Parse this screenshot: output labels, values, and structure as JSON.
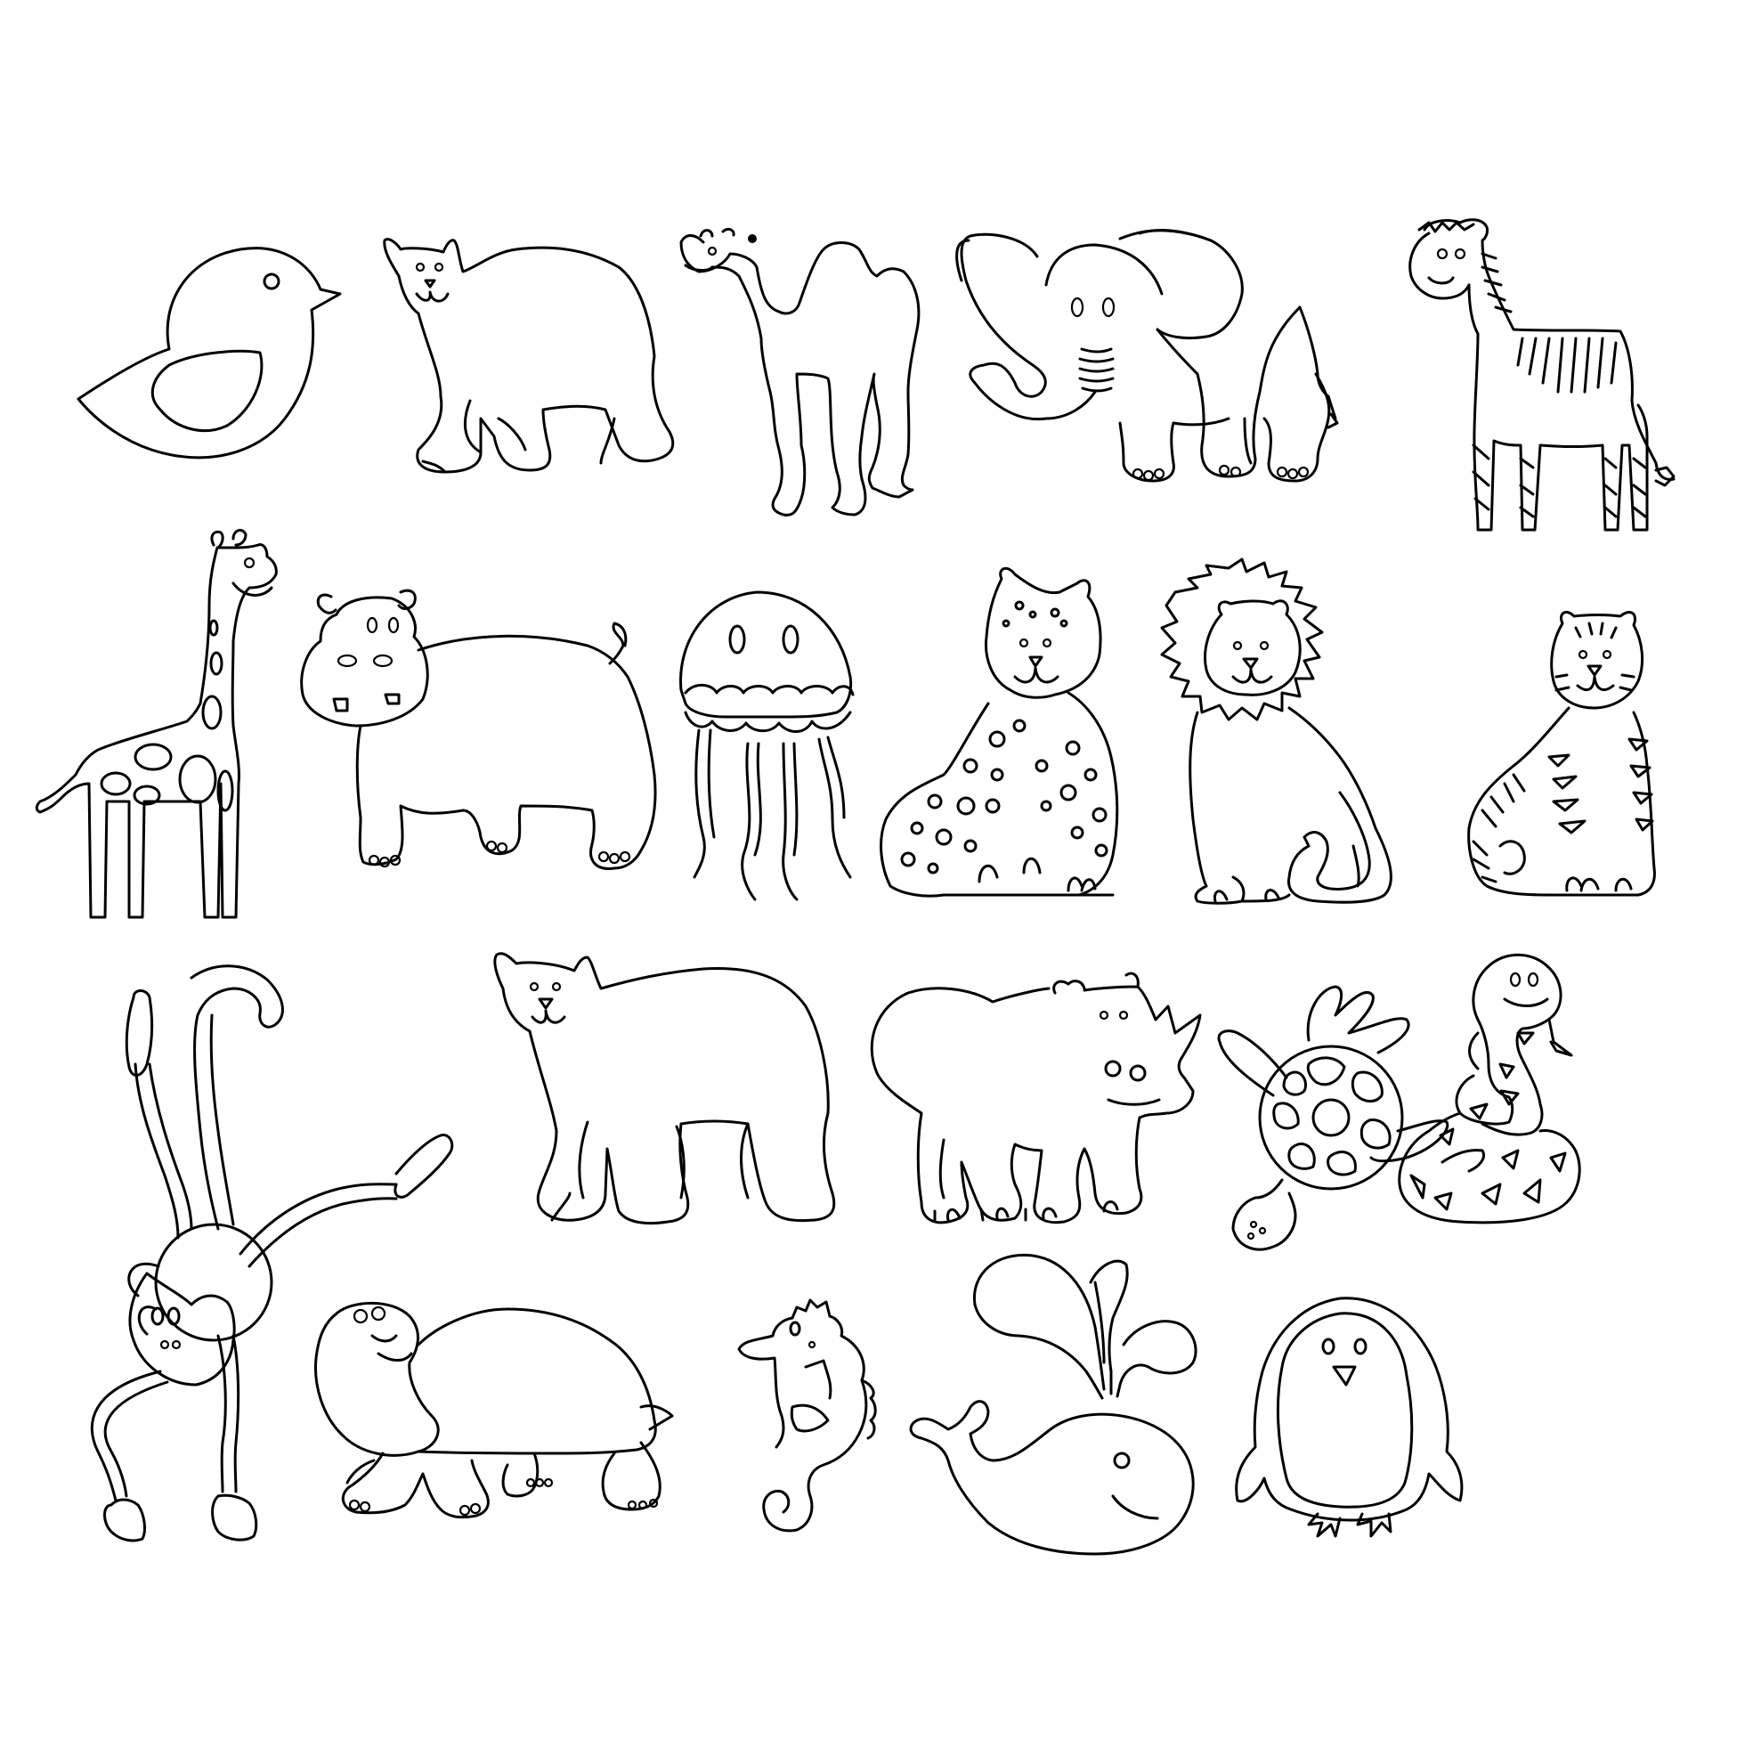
{
  "page": {
    "background": "#ffffff",
    "ink": "#000000",
    "style": "coloring-page line art"
  },
  "animals": [
    {
      "id": "bird-icon"
    },
    {
      "id": "polar-bear-icon"
    },
    {
      "id": "camel-icon"
    },
    {
      "id": "elephant-icon"
    },
    {
      "id": "zebra-icon"
    },
    {
      "id": "giraffe-icon"
    },
    {
      "id": "hippo-icon"
    },
    {
      "id": "jellyfish-icon"
    },
    {
      "id": "leopard-icon"
    },
    {
      "id": "lion-icon"
    },
    {
      "id": "tiger-icon"
    },
    {
      "id": "monkey-icon"
    },
    {
      "id": "bear-icon"
    },
    {
      "id": "rhino-icon"
    },
    {
      "id": "sea-turtle-icon"
    },
    {
      "id": "snake-icon"
    },
    {
      "id": "tortoise-icon"
    },
    {
      "id": "seahorse-icon"
    },
    {
      "id": "whale-icon"
    },
    {
      "id": "penguin-icon"
    }
  ]
}
